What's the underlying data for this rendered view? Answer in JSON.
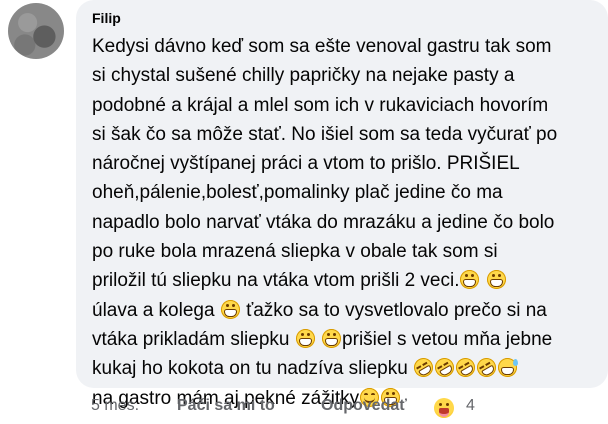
{
  "comment": {
    "author": "Filip",
    "body": [
      {
        "t": "text",
        "v": "Kedysi dávno keď som sa ešte venoval gastru tak som\nsi chystal sušené chilly papričky na nejake pasty a\npodobné a krájal a mlel som ich v rukaviciach hovorím\nsi šak čo sa môže stať. No išiel som sa teda vyčurať po\nnáročnej vyštípanej práci a vtom to prišlo. PRIŠIEL\noheň,pálenie,bolesť,pomalinky plač jedine čo ma\nnapadlo bolo narvať vtáka do mrazáku a jedine čo bolo\npo ruke bola mrazená sliepka v obale tak som si\npriložil tú sliepku na vtáka vtom prišli 2 veci."
      },
      {
        "t": "emoji",
        "v": "grin"
      },
      {
        "t": "text",
        "v": " "
      },
      {
        "t": "emoji",
        "v": "grin"
      },
      {
        "t": "text",
        "v": "\núlava a kolega "
      },
      {
        "t": "emoji",
        "v": "grin"
      },
      {
        "t": "text",
        "v": "  ťažko sa to vysvetlovalo prečo si na\nvtáka prikladám sliepku "
      },
      {
        "t": "emoji",
        "v": "grin"
      },
      {
        "t": "text",
        "v": " "
      },
      {
        "t": "emoji",
        "v": "grin"
      },
      {
        "t": "text",
        "v": "prišiel s vetou mňa jebne\nkukaj ho kokota on tu nadzíva sliepku "
      },
      {
        "t": "emoji",
        "v": "rofl"
      },
      {
        "t": "emoji",
        "v": "rofl"
      },
      {
        "t": "emoji",
        "v": "rofl"
      },
      {
        "t": "emoji",
        "v": "rofl"
      },
      {
        "t": "emoji",
        "v": "sweat"
      },
      {
        "t": "text",
        "v": "\nna gastro mám aj pekné zážitky"
      },
      {
        "t": "emoji",
        "v": "smile"
      },
      {
        "t": "emoji",
        "v": "grin"
      }
    ],
    "bubble_color": "#f0f2f5"
  },
  "actions": {
    "time": "5 mes.",
    "like_label": "Páči sa mi to",
    "reply_label": "Odpovedať",
    "reaction_icon": "laughing-tongue-emoji",
    "reaction_count": "4"
  },
  "colors": {
    "text": "#050505",
    "meta": "#65676b"
  }
}
